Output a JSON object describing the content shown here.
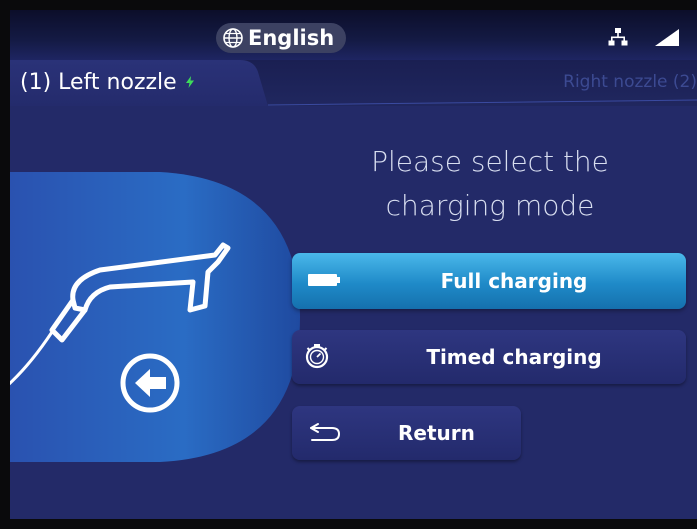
{
  "header": {
    "language": "English",
    "icons": [
      "globe-icon",
      "network-icon",
      "signal-icon"
    ]
  },
  "tabs": {
    "left": "(1)  Left nozzle",
    "right": "Right nozzle (2)"
  },
  "prompt": {
    "line1": "Please select the",
    "line2": "charging mode"
  },
  "buttons": {
    "full": "Full charging",
    "timed": "Timed charging",
    "return": "Return"
  },
  "colors": {
    "background": "#232a68",
    "accent": "#1f8ac8",
    "active_bolt": "#3ddc5a"
  }
}
